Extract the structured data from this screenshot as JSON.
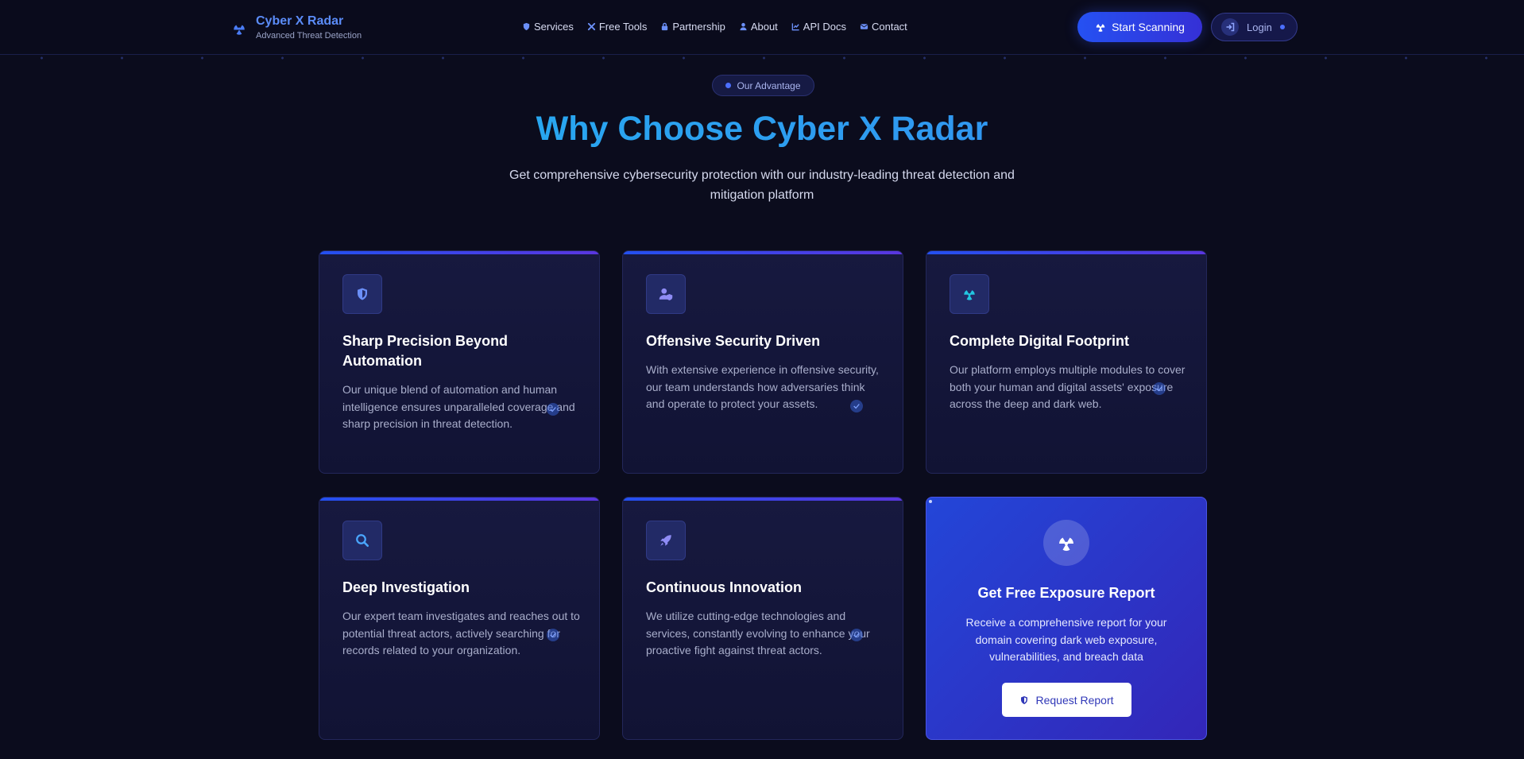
{
  "brand": {
    "title": "Cyber X Radar",
    "subtitle": "Advanced Threat Detection",
    "icon": "radiation-icon"
  },
  "nav": [
    {
      "label": "Services",
      "icon": "shield-icon"
    },
    {
      "label": "Free Tools",
      "icon": "tools-icon"
    },
    {
      "label": "Partnership",
      "icon": "lock-icon"
    },
    {
      "label": "About",
      "icon": "user-icon"
    },
    {
      "label": "API Docs",
      "icon": "chart-icon"
    },
    {
      "label": "Contact",
      "icon": "envelope-icon"
    }
  ],
  "header_actions": {
    "scan_label": "Start Scanning",
    "login_label": "Login"
  },
  "section": {
    "badge": "Our Advantage",
    "title": "Why Choose Cyber X Radar",
    "subtitle": "Get comprehensive cybersecurity protection with our industry-leading threat detection and mitigation platform"
  },
  "features": [
    {
      "title": "Sharp Precision Beyond Automation",
      "description": "Our unique blend of automation and human intelligence ensures unparalleled coverage and sharp precision in threat detection.",
      "icon": "shield-icon"
    },
    {
      "title": "Offensive Security Driven",
      "description": "With extensive experience in offensive security, our team understands how adversaries think and operate to protect your assets.",
      "icon": "user-shield-icon"
    },
    {
      "title": "Complete Digital Footprint",
      "description": "Our platform employs multiple modules to cover both your human and digital assets' exposure across the deep and dark web.",
      "icon": "radiation-icon"
    },
    {
      "title": "Deep Investigation",
      "description": "Our expert team investigates and reaches out to potential threat actors, actively searching for records related to your organization.",
      "icon": "search-icon"
    },
    {
      "title": "Continuous Innovation",
      "description": "We utilize cutting-edge technologies and services, constantly evolving to enhance your proactive fight against threat actors.",
      "icon": "rocket-icon"
    }
  ],
  "cta": {
    "title": "Get Free Exposure Report",
    "description": "Receive a comprehensive report for your domain covering dark web exposure, vulnerabilities, and breach data",
    "button_label": "Request Report",
    "icon": "radiation-icon"
  },
  "colors": {
    "background": "#0b0c1d",
    "accent": "#2551f2",
    "title_gradient_start": "#1fb7ef",
    "cta_gradient_start": "#2346d8",
    "cta_gradient_end": "#3326b8"
  }
}
